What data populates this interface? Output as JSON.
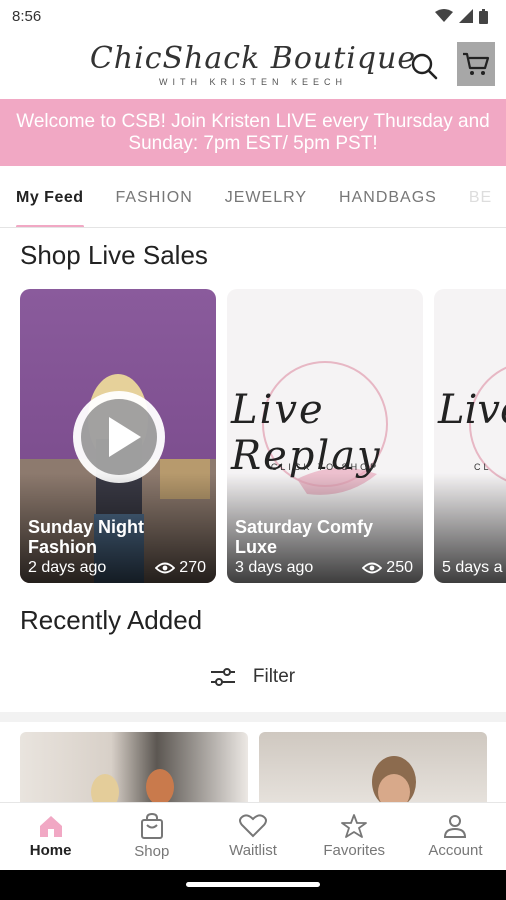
{
  "status": {
    "time": "8:56"
  },
  "header": {
    "logo_script": "ChicShack Boutique",
    "logo_sub": "WITH KRISTEN KEECH",
    "search_icon": "search-icon",
    "cart_icon": "cart-icon"
  },
  "banner": {
    "text": "Welcome to CSB! Join Kristen LIVE every Thursday and Sunday: 7pm EST/ 5pm PST!"
  },
  "tabs": [
    {
      "label": "My Feed"
    },
    {
      "label": "FASHION"
    },
    {
      "label": "JEWELRY"
    },
    {
      "label": "HANDBAGS"
    },
    {
      "label": "BE"
    }
  ],
  "live": {
    "title": "Shop Live Sales",
    "cards": [
      {
        "title": "Sunday Night Fashion",
        "ago": "2 days ago",
        "views": "270"
      },
      {
        "title": "Saturday Comfy Luxe",
        "ago": "3 days ago",
        "views": "250",
        "art_title": "Live Replay",
        "art_sub": "CLICK TO SHOP"
      },
      {
        "ago": "5 days a",
        "art_title": "Live",
        "art_sub": "CL"
      }
    ]
  },
  "recent": {
    "title": "Recently Added",
    "filter_label": "Filter"
  },
  "nav": [
    {
      "label": "Home",
      "icon": "home-icon"
    },
    {
      "label": "Shop",
      "icon": "shopping-bag-icon"
    },
    {
      "label": "Waitlist",
      "icon": "heart-icon"
    },
    {
      "label": "Favorites",
      "icon": "star-icon"
    },
    {
      "label": "Account",
      "icon": "person-icon"
    }
  ],
  "colors": {
    "accent": "#f1a8c4",
    "cart_bg": "#a7a7a7"
  }
}
